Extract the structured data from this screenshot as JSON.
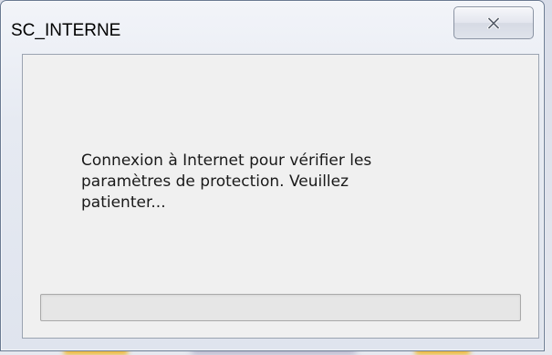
{
  "window": {
    "title": "SC_INTERNE"
  },
  "dialog": {
    "message": "Connexion à Internet pour vérifier les\nparamètres de protection. Veuillez\npatienter..."
  },
  "progress": {
    "value": 0
  },
  "icons": {
    "close": "close-icon"
  },
  "colors": {
    "client_background": "#f0f0f0",
    "frame": "#e6eaf2",
    "progress_track": "#e6e6e6"
  }
}
